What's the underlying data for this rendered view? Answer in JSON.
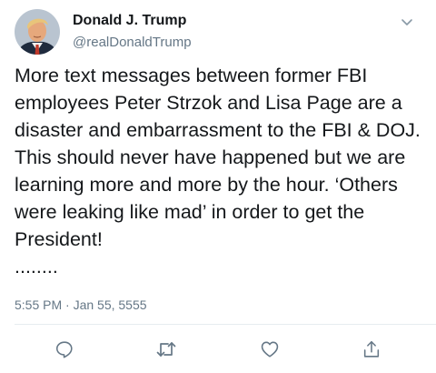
{
  "user": {
    "display_name": "Donald J. Trump",
    "handle": "@realDonaldTrump"
  },
  "tweet": {
    "text": "More text messages between former FBI employees Peter Strzok and Lisa Page are a disaster and embarrassment to the FBI & DOJ. This should never have happened but we are learning more and more by the hour. ‘Others were leaking like mad’ in order to get the President!\n........",
    "timestamp": "5:55 PM · Jan 55, 5555"
  },
  "icons": {
    "caret": "chevron-down-icon",
    "reply": "reply-icon",
    "retweet": "retweet-icon",
    "like": "heart-icon",
    "share": "share-icon"
  },
  "colors": {
    "icon_gray": "#657786",
    "text": "#14171a",
    "divider": "#e6ecf0"
  }
}
